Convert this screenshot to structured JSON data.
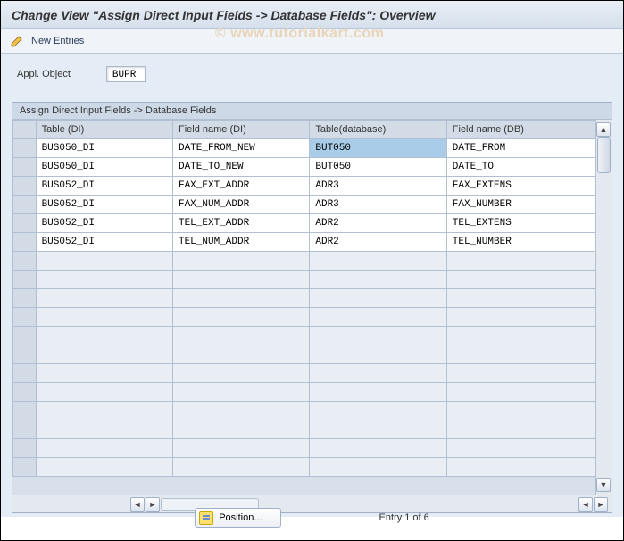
{
  "title": "Change View \"Assign Direct Input Fields -> Database Fields\": Overview",
  "toolbar": {
    "new_entries_label": "New Entries"
  },
  "watermark": "© www.tutorialkart.com",
  "appl": {
    "label": "Appl. Object",
    "value": "BUPR"
  },
  "table": {
    "caption": "Assign Direct Input Fields -> Database Fields",
    "columns": [
      "Table (DI)",
      "Field name (DI)",
      "Table(database)",
      "Field name (DB)"
    ],
    "rows": [
      {
        "di_table": "BUS050_DI",
        "di_field": "DATE_FROM_NEW",
        "db_table": "BUT050",
        "db_field": "DATE_FROM",
        "hl": 2
      },
      {
        "di_table": "BUS050_DI",
        "di_field": "DATE_TO_NEW",
        "db_table": "BUT050",
        "db_field": "DATE_TO"
      },
      {
        "di_table": "BUS052_DI",
        "di_field": "FAX_EXT_ADDR",
        "db_table": "ADR3",
        "db_field": "FAX_EXTENS"
      },
      {
        "di_table": "BUS052_DI",
        "di_field": "FAX_NUM_ADDR",
        "db_table": "ADR3",
        "db_field": "FAX_NUMBER"
      },
      {
        "di_table": "BUS052_DI",
        "di_field": "TEL_EXT_ADDR",
        "db_table": "ADR2",
        "db_field": "TEL_EXTENS"
      },
      {
        "di_table": "BUS052_DI",
        "di_field": "TEL_NUM_ADDR",
        "db_table": "ADR2",
        "db_field": "TEL_NUMBER"
      }
    ],
    "empty_rows": 12
  },
  "footer": {
    "position_label": "Position...",
    "entry_label": "Entry 1 of 6"
  }
}
